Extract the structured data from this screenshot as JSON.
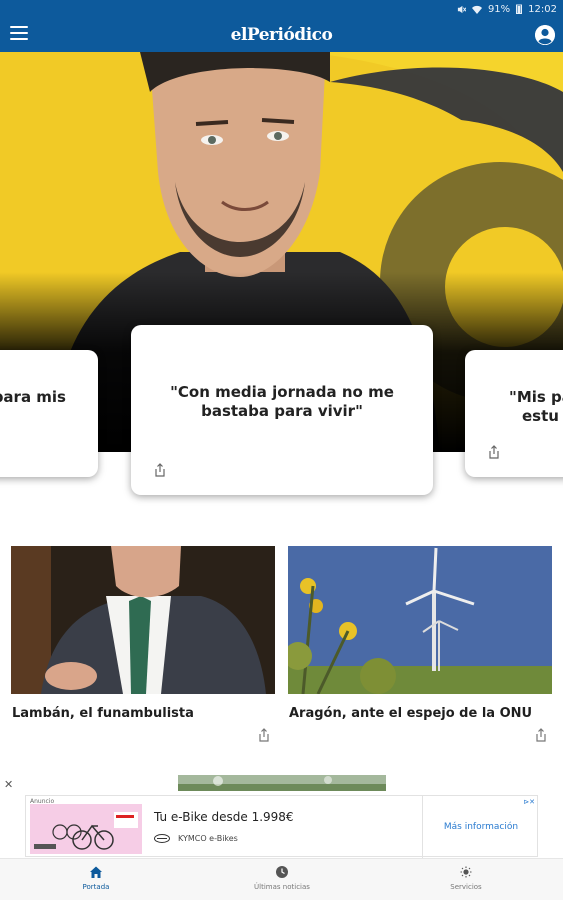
{
  "status_bar": {
    "battery": "91%",
    "time": "12:02"
  },
  "app_bar": {
    "logo": "elPeriódico",
    "menu_icon": "hamburger-menu-icon",
    "account_icon": "account-circle-icon"
  },
  "carousel": {
    "cards": [
      {
        "quote": "para mis"
      },
      {
        "quote": "\"Con media jornada no me bastaba para vivir\""
      },
      {
        "quote": "\"Mis pa\nestu"
      }
    ]
  },
  "articles": [
    {
      "title": "Lambán, el funambulista"
    },
    {
      "title": "Aragón, ante el espejo de la ONU"
    }
  ],
  "ad": {
    "close": "✕",
    "badge": "Anuncio",
    "title": "Tu e-Bike desde 1.998€",
    "brand": "KYMCO e-Bikes",
    "cta": "Más información",
    "choices": "⊳✕"
  },
  "bottom_nav": [
    {
      "label": "Portada",
      "icon": "home-icon",
      "active": true
    },
    {
      "label": "Últimas noticias",
      "icon": "clock-icon",
      "active": false
    },
    {
      "label": "Servicios",
      "icon": "services-icon",
      "active": false
    }
  ],
  "colors": {
    "brand": "#0d5a9c",
    "hero_yellow": "#f1ca26",
    "ad_link": "#2a7bd0"
  }
}
